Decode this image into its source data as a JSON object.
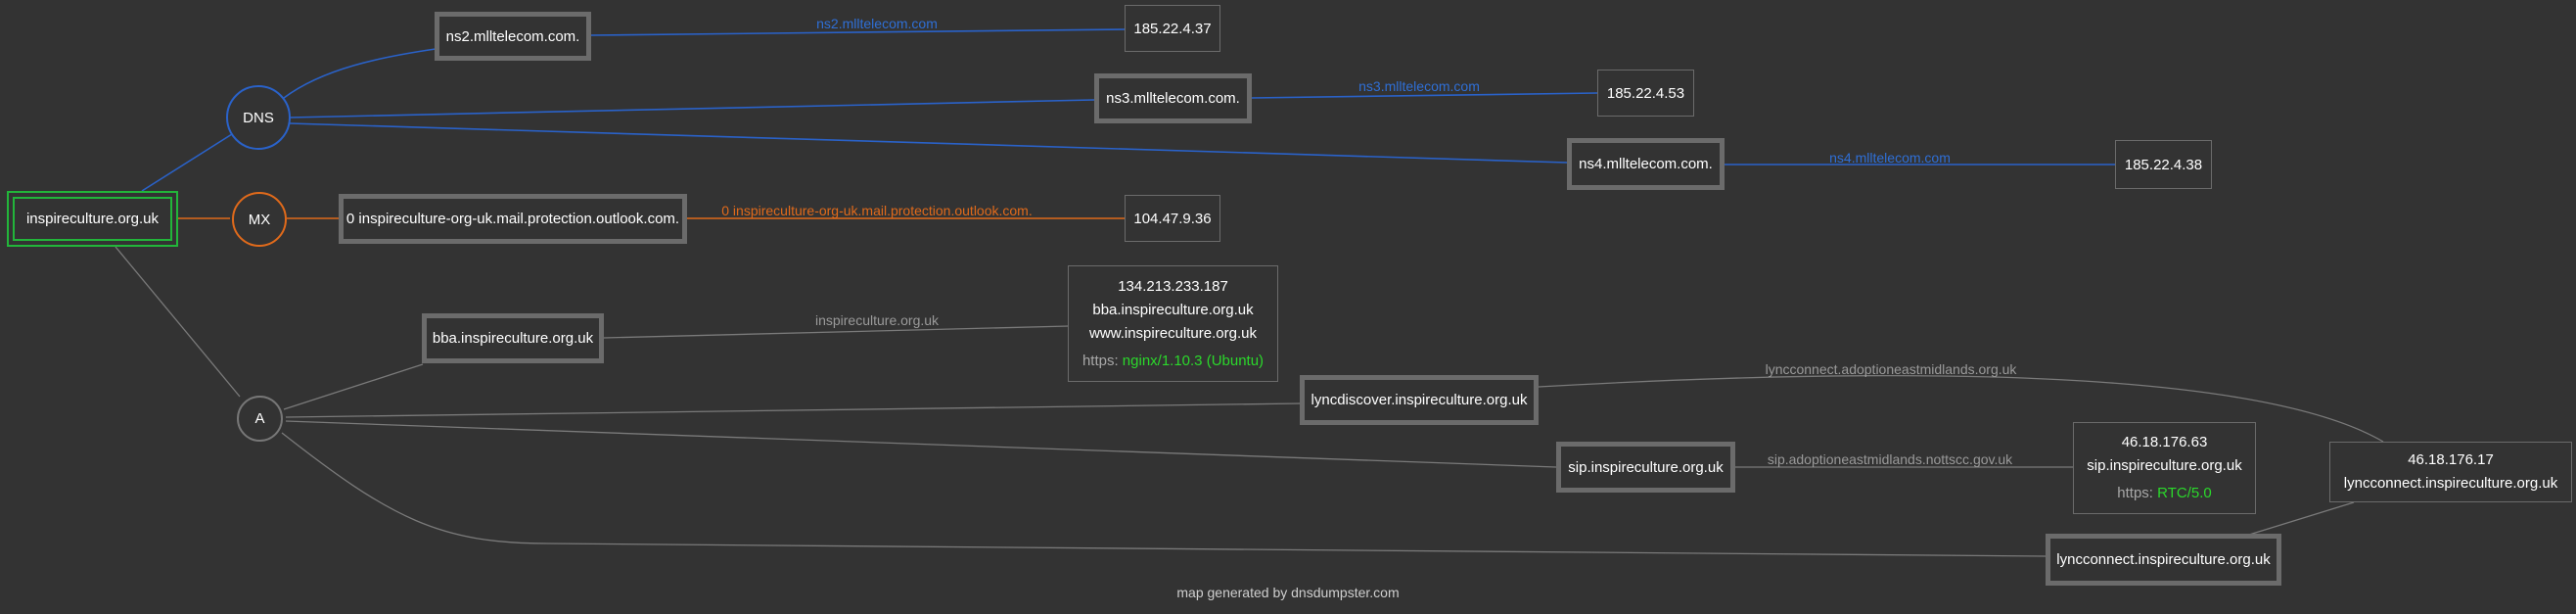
{
  "domain": "inspireculture.org.uk",
  "groups": {
    "dns": "DNS",
    "mx": "MX",
    "a": "A"
  },
  "colors": {
    "background": "#333333",
    "dns_edge": "#2a62c9",
    "mx_edge": "#e06a1b",
    "a_edge": "#7a7a7a",
    "root_border": "#22b53a",
    "server_text": "#2bd82b"
  },
  "dns_records": [
    {
      "host": "ns2.mlltelecom.com.",
      "ip": "185.22.4.37",
      "edge_label": "ns2.mlltelecom.com"
    },
    {
      "host": "ns3.mlltelecom.com.",
      "ip": "185.22.4.53",
      "edge_label": "ns3.mlltelecom.com"
    },
    {
      "host": "ns4.mlltelecom.com.",
      "ip": "185.22.4.38",
      "edge_label": "ns4.mlltelecom.com"
    }
  ],
  "mx_records": [
    {
      "host": "0 inspireculture-org-uk.mail.protection.outlook.com.",
      "ip": "104.47.9.36",
      "edge_label": "0 inspireculture-org-uk.mail.protection.outlook.com."
    }
  ],
  "a_records": {
    "bba": {
      "host": "bba.inspireculture.org.uk",
      "edge_label": "inspireculture.org.uk",
      "ip_box": {
        "ip": "134.213.233.187",
        "names": [
          "bba.inspireculture.org.uk",
          "www.inspireculture.org.uk"
        ],
        "https_label": "https:",
        "https_server": "nginx/1.10.3 (Ubuntu)"
      }
    },
    "lyncdiscover": {
      "host": "lyncdiscover.inspireculture.org.uk",
      "edge_label": "lyncconnect.adoptioneastmidlands.org.uk"
    },
    "sip": {
      "host": "sip.inspireculture.org.uk",
      "edge_label": "sip.adoptioneastmidlands.nottscc.gov.uk",
      "ip_box": {
        "ip": "46.18.176.63",
        "names": [
          "sip.inspireculture.org.uk"
        ],
        "https_label": "https:",
        "https_server": "RTC/5.0"
      }
    },
    "lyncconnect": {
      "host": "lyncconnect.inspireculture.org.uk",
      "ip_box": {
        "ip": "46.18.176.17",
        "names": [
          "lyncconnect.inspireculture.org.uk"
        ]
      }
    }
  },
  "footer": "map generated by dnsdumpster.com"
}
